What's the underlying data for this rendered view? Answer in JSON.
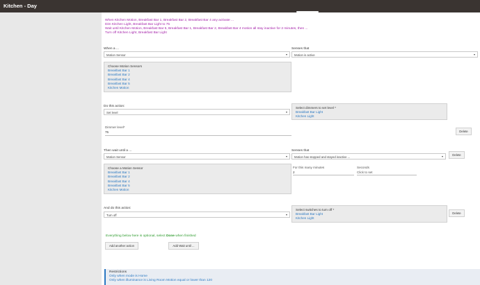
{
  "window": {
    "title": "Kitchen - Day"
  },
  "summary_lines": [
    "When Kitchen Motion, Breakfast Bar 1, Breakfast Bar 2, Breakfast Bar 4 any activate ...",
    "Dim Kitchen Light, Breakfast Bar Light to 75",
    "Wait until Kitchen Motion, Breakfast Bar 5, Breakfast Bar 1, Breakfast Bar 2, Breakfast Bar 4 motion all stay inactive for 2 minutes, then ...",
    "Turn off Kitchen Light, Breakfast Bar Light"
  ],
  "trigger": {
    "when_label": "When a ...",
    "when_value": "Motion Sensor",
    "senses_label": "Senses that",
    "senses_value": "Motion is active",
    "devices_header": "Choose Motion Sensors",
    "devices": [
      "Breakfast Bar 1",
      "Breakfast Bar 2",
      "Breakfast Bar 4",
      "Breakfast Bar 5",
      "Kitchen Motion"
    ]
  },
  "action1": {
    "label": "Do this action:",
    "value": "Set level",
    "dimmers_header": "Select dimmers to set level *",
    "dimmers": [
      "Breakfast Bar Light",
      "Kitchen Light"
    ],
    "level_label": "Dimmer level*",
    "level_value": "75",
    "delete_label": "Delete"
  },
  "wait": {
    "label": "Then wait until a ...",
    "value": "Motion Sensor",
    "senses_label": "Senses that",
    "senses_value": "Motion has stopped and stayed inactive ...",
    "delete_label": "Delete",
    "devices_header": "Choose a Motion Sensor",
    "devices": [
      "Breakfast Bar 1",
      "Breakfast Bar 2",
      "Breakfast Bar 4",
      "Breakfast Bar 5",
      "Kitchen Motion"
    ],
    "minutes_label": "For this many minutes",
    "minutes_value": "2",
    "seconds_label": "Seconds",
    "seconds_placeholder": "Click to set"
  },
  "action2": {
    "label": "And do this action:",
    "value": "Turn off",
    "switches_header": "Select switches to turn off *",
    "switches": [
      "Breakfast Bar Light",
      "Kitchen Light"
    ],
    "delete_label": "Delete"
  },
  "optional": {
    "prefix": "Everything below here is optional, select ",
    "done": "Done",
    "suffix": " when finished"
  },
  "buttons": {
    "add_action": "Add another action",
    "add_wait": "Add Wait until ..."
  },
  "restrictions": {
    "header": "Restrictions",
    "items": [
      "Only when mode is Home",
      "Only when illuminance is Living Room Motion equal or lower than 120"
    ]
  },
  "colors": {
    "topbar": "#3a3431",
    "summary": "#a31fa8",
    "link": "#2a78c2",
    "optional_text": "#2e9b2e"
  }
}
